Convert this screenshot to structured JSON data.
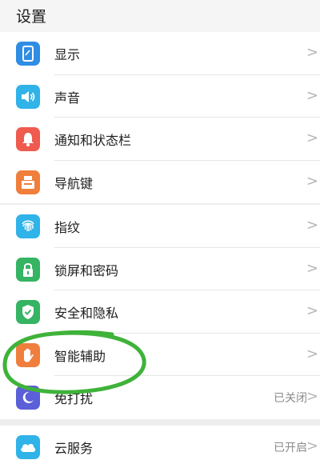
{
  "header": {
    "title": "设置"
  },
  "group1": [
    {
      "label": "显示",
      "icon": "display-icon",
      "color": "#2f8de4"
    },
    {
      "label": "声音",
      "icon": "sound-icon",
      "color": "#2fb3e8"
    },
    {
      "label": "通知和状态栏",
      "icon": "bell-icon",
      "color": "#ef5b4f"
    },
    {
      "label": "导航键",
      "icon": "navigation-key-icon",
      "color": "#f07e3c"
    }
  ],
  "group2": [
    {
      "label": "指纹",
      "icon": "fingerprint-icon",
      "color": "#2fb3e8"
    },
    {
      "label": "锁屏和密码",
      "icon": "lock-icon",
      "color": "#35b463"
    },
    {
      "label": "安全和隐私",
      "icon": "shield-icon",
      "color": "#35b463"
    },
    {
      "label": "智能辅助",
      "icon": "hand-icon",
      "color": "#f07e3c"
    },
    {
      "label": "免打扰",
      "icon": "moon-icon",
      "color": "#5b5fd8",
      "value": "已关闭"
    }
  ],
  "group3": [
    {
      "label": "云服务",
      "icon": "cloud-icon",
      "color": "#2fb3e8",
      "value": "已开启"
    }
  ],
  "chevron": ">",
  "annotation_color": "#3fb23a"
}
